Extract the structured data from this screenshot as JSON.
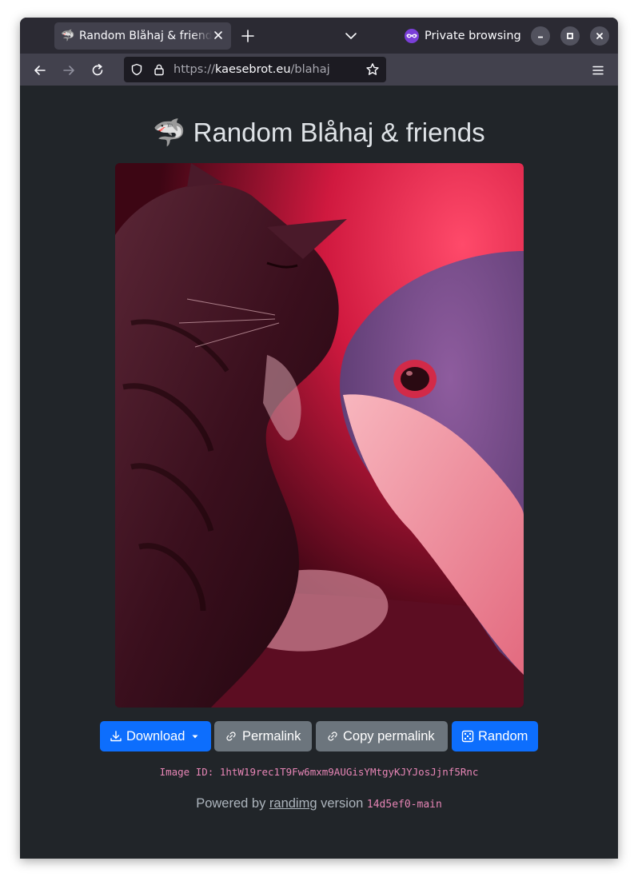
{
  "browser": {
    "tab_favicon": "🦈",
    "tab_title": "Random Blåhaj & friends",
    "private_label": "Private browsing",
    "url_scheme": "https://",
    "url_host": "kaesebrot.eu",
    "url_path": "/blahaj",
    "icons": [
      "shark-favicon-icon",
      "close-icon",
      "plus-icon",
      "chevron-down-icon",
      "private-mask-icon",
      "minimize-icon",
      "maximize-icon",
      "window-close-icon",
      "back-arrow-icon",
      "forward-arrow-icon",
      "reload-icon",
      "shield-icon",
      "lock-icon",
      "star-icon",
      "hamburger-menu-icon"
    ]
  },
  "page": {
    "title_emoji": "🦈",
    "title": "Random Blåhaj & friends",
    "buttons": {
      "download": "Download",
      "permalink": "Permalink",
      "copy_permalink": "Copy permalink",
      "random": "Random"
    },
    "image_id": "Image ID: 1htW19rec1T9Fw6mxm9AUGisYMtgyKJYJosJjnf5Rnc",
    "powered_prefix": "Powered by ",
    "powered_link": "randimg",
    "powered_middle": " version ",
    "version": "14d5ef0-main"
  },
  "colors": {
    "page_bg": "#212529",
    "primary": "#0d6efd",
    "secondary": "#6c757d",
    "code_pink": "#e685b5",
    "photo_red": "#e8294f"
  }
}
